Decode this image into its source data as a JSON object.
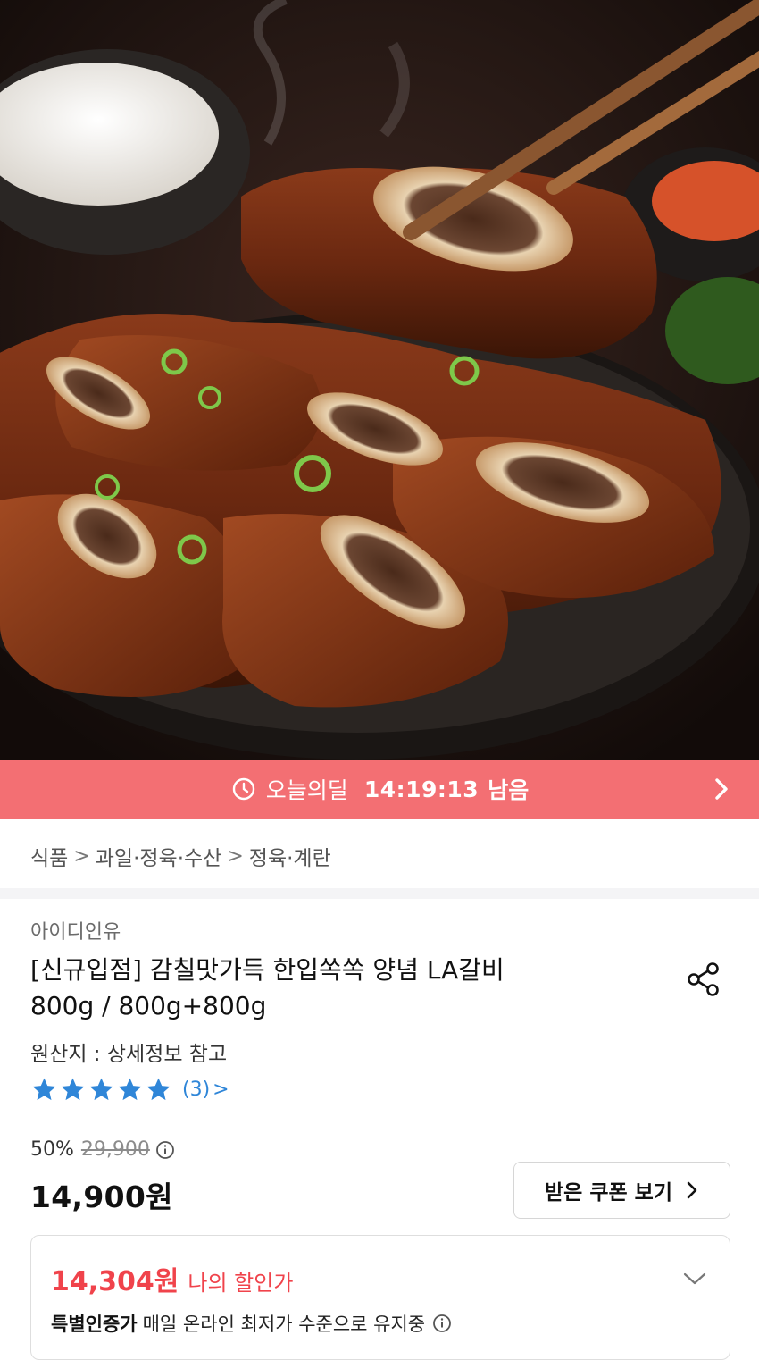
{
  "hero": {
    "image_description_icon": "grilled-la-galbi-photo-icon"
  },
  "deal": {
    "label": "오늘의딜",
    "timer": "14:19:13",
    "remain": "남음",
    "icon": "clock-icon",
    "arrow_icon": "chevron-right-icon",
    "bg_color": "#f36f73"
  },
  "breadcrumb": {
    "items": [
      "식품",
      "과일·정육·수산",
      "정육·계란"
    ],
    "separator": ">"
  },
  "product": {
    "seller": "아이디인유",
    "title_line1": "[신규입점] 감칠맛가득 한입쏙쏙 양념 LA갈비",
    "title_line2": "800g / 800g+800g",
    "origin": "원산지 : 상세정보 참고",
    "rating": {
      "stars": 5,
      "max": 5,
      "count_text": "(3)",
      "chevron": ">",
      "color": "#2f86d8"
    }
  },
  "pricing": {
    "discount": "50%",
    "original": "29,900",
    "price": "14,900원",
    "coupon_button": "받은 쿠폰 보기"
  },
  "my_price": {
    "price": "14,304원",
    "label": "나의 할인가",
    "cert": "특별인증가",
    "cert_desc": "매일 온라인 최저가 수준으로 유지중",
    "accent": "#f0434b"
  }
}
